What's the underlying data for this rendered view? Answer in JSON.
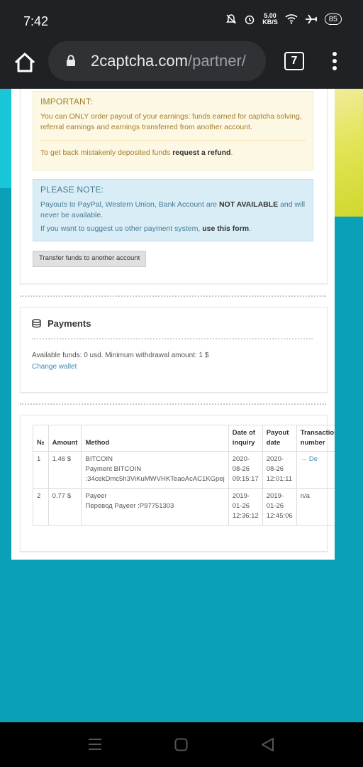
{
  "status": {
    "time": "7:42",
    "speed": "5.00",
    "speed_unit": "KB/S",
    "battery": "85"
  },
  "browser": {
    "url_domain": "2captcha.com",
    "url_path": "/partner/",
    "tab_count": "7"
  },
  "important": {
    "title": "IMPORTANT:",
    "text1": "You can ONLY order payout of your earnings: funds earned for captcha solving, referral earnings and earnings transferred from another account.",
    "text2_pre": "To get back mistakenly deposited funds ",
    "text2_link": "request a refund",
    "text2_post": "."
  },
  "please_note": {
    "title": "PLEASE NOTE:",
    "text1_pre": "Payouts to PayPal, Western Union, Bank Account are ",
    "text1_bold": "NOT AVAILABLE",
    "text1_post": " and will never be available.",
    "text2_pre": "If you want to suggest us other payment system, ",
    "text2_link": "use this form",
    "text2_post": "."
  },
  "transfer_button": "Transfer funds to another account",
  "payments": {
    "title": "Payments",
    "available": "Available funds: 0 usd. Minimum withdrawal amount: 1 $",
    "change_wallet": "Change wallet"
  },
  "table": {
    "headers": {
      "num": "№",
      "amount": "Amount",
      "method": "Method",
      "date_inquiry": "Date of inquiry",
      "payout_date": "Payout date",
      "transaction": "Transaction number"
    },
    "rows": [
      {
        "num": "1",
        "amount": "1.46 $",
        "method_name": "BITCOIN",
        "method_detail1": "Payment BITCOIN",
        "method_detail2": ":34cekDmc5h3ViKuMWVHKTeaoAcAC1KGpej",
        "inquiry_date": "2020-08-26",
        "inquiry_time": "09:15:17",
        "payout_date": "2020-08-26",
        "payout_time": "12:01:11",
        "transaction": "→ De"
      },
      {
        "num": "2",
        "amount": "0.77 $",
        "method_name": "Payeer",
        "method_detail1": "Перевод Payeer :P97751303",
        "method_detail2": "",
        "inquiry_date": "2019-01-26",
        "inquiry_time": "12:36:12",
        "payout_date": "2019-01-26",
        "payout_time": "12:45:06",
        "transaction": "n/a"
      }
    ]
  }
}
